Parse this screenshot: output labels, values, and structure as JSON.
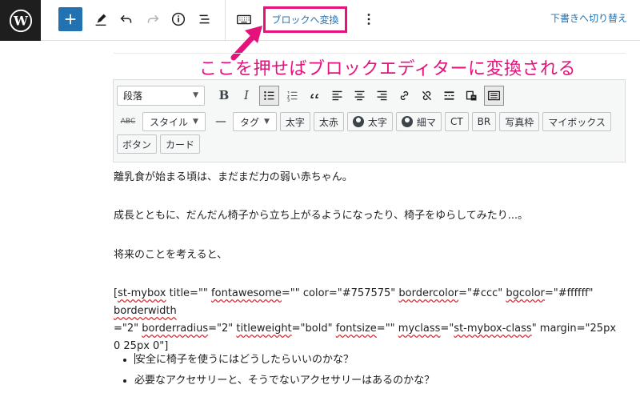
{
  "topbar": {
    "convert_label": "ブロックへ変換",
    "draft_label": "下書きへ切り替え"
  },
  "annotation": "ここを押せばブロックエディターに変換される",
  "classic_toolbar": {
    "format_select": "段落",
    "row2": {
      "style_label": "スタイル",
      "dash": "—",
      "tag_label": "タグ",
      "btn_bold_large": "太字",
      "btn_bold_red": "太赤",
      "btn_user_bold": "太字",
      "btn_user_thin": "細マ",
      "btn_ct": "CT",
      "btn_br": "BR",
      "btn_photo_frame": "写真枠",
      "btn_mybox": "マイボックス"
    },
    "row3": {
      "btn_button": "ボタン",
      "btn_card": "カード"
    },
    "strike_label": "ABC"
  },
  "content": {
    "p1": "離乳食が始まる頃は、まだまだ力の弱い赤ちゃん。",
    "p2": "成長とともに、だんだん椅子から立ち上がるようになったり、椅子をゆらしてみたり...。",
    "p3": "将来のことを考えると、",
    "shortcode": {
      "s1": "[",
      "w1": "st-mybox",
      "s2": " title=\"\" ",
      "w2": "fontawesome",
      "s3": "=\"\" color=\"#757575\" ",
      "w3": "bordercolor",
      "s4": "=\"#ccc\" ",
      "w4": "bgcolor",
      "s5": "=\"#ffffff\" ",
      "w5": "borderwidth",
      "s6": "=\"2\" ",
      "w6": "borderradius",
      "s7": "=\"2\" ",
      "w7": "titleweight",
      "s8": "=\"bold\" ",
      "w8": "fontsize",
      "s9": "=\"\" ",
      "w9": "myclass",
      "s10": "=\"",
      "w10": "st-mybox-class",
      "s11": "\" margin=\"25px 0 25px 0\"]"
    },
    "bullets": [
      "安全に椅子を使うにはどうしたらいいのかな？",
      "必要なアクセサリーと、そうでないアクセサリーはあるのかな？"
    ]
  },
  "colors": {
    "accent_blue": "#2271b1",
    "annotation_pink": "#e6127c",
    "wp_dark": "#1e1e1e"
  },
  "icons": [
    "wordpress-logo-icon",
    "plus-icon",
    "pencil-icon",
    "undo-icon",
    "redo-icon",
    "info-icon",
    "list-view-icon",
    "keyboard-icon",
    "more-vertical-icon"
  ]
}
